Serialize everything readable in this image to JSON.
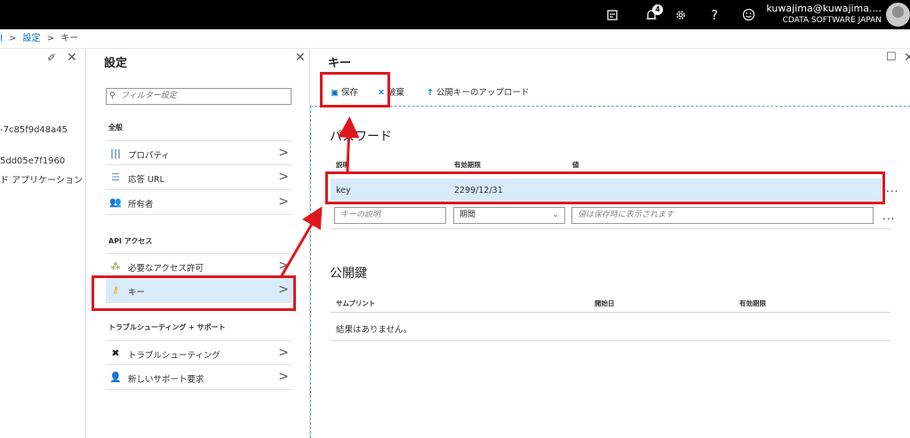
{
  "topbar": {
    "notification_count": "4",
    "user_name": "kuwajima@kuwajima....",
    "user_org": "CDATA SOFTWARE JAPAN",
    "icons": [
      "feedback-icon",
      "notification-icon",
      "gear-icon",
      "help-icon",
      "smiley-icon"
    ]
  },
  "breadcrumb": {
    "lead": "l",
    "settings": "設定",
    "key": "キー",
    "sep": ">"
  },
  "left_blade": {
    "line1": "-7c85f9d48a45",
    "line2": "5dd05e7f1960",
    "line3": "ド アプリケーション"
  },
  "settings_blade": {
    "title": "設定",
    "filter_placeholder": "フィルター設定",
    "general_header": "全般",
    "general_items": [
      {
        "label": "プロパティ",
        "icon": "properties-icon"
      },
      {
        "label": "応答 URL",
        "icon": "list-icon"
      },
      {
        "label": "所有者",
        "icon": "users-icon"
      }
    ],
    "api_header": "API アクセス",
    "api_items": [
      {
        "label": "必要なアクセス許可",
        "icon": "permissions-icon"
      },
      {
        "label": "キー",
        "icon": "key-icon"
      }
    ],
    "support_header": "トラブルシューティング + サポート",
    "support_items": [
      {
        "label": "トラブルシューティング",
        "icon": "tools-icon"
      },
      {
        "label": "新しいサポート要求",
        "icon": "support-icon"
      }
    ]
  },
  "key_blade": {
    "title": "キー",
    "toolbar": {
      "save": "保存",
      "discard": "破棄",
      "upload": "公開キーのアップロード"
    },
    "password_title": "パスワード",
    "password_columns": [
      "説明",
      "有効期限",
      "値"
    ],
    "key_row": {
      "description": "key",
      "expires": "2299/12/31",
      "value": ""
    },
    "new_row": {
      "description_placeholder": "キーの説明",
      "duration_value": "期間",
      "value_placeholder": "値は保存時に表示されます"
    },
    "more": "...",
    "public_key_title": "公開鍵",
    "public_columns": [
      "サムプリント",
      "開始日",
      "有効期限"
    ],
    "public_empty": "結果はありません。"
  },
  "colors": {
    "topbar_bg": "#000000",
    "accent": "#0072c6",
    "selected_row": "#d9ebf9",
    "annotation_red": "#e0161d"
  }
}
